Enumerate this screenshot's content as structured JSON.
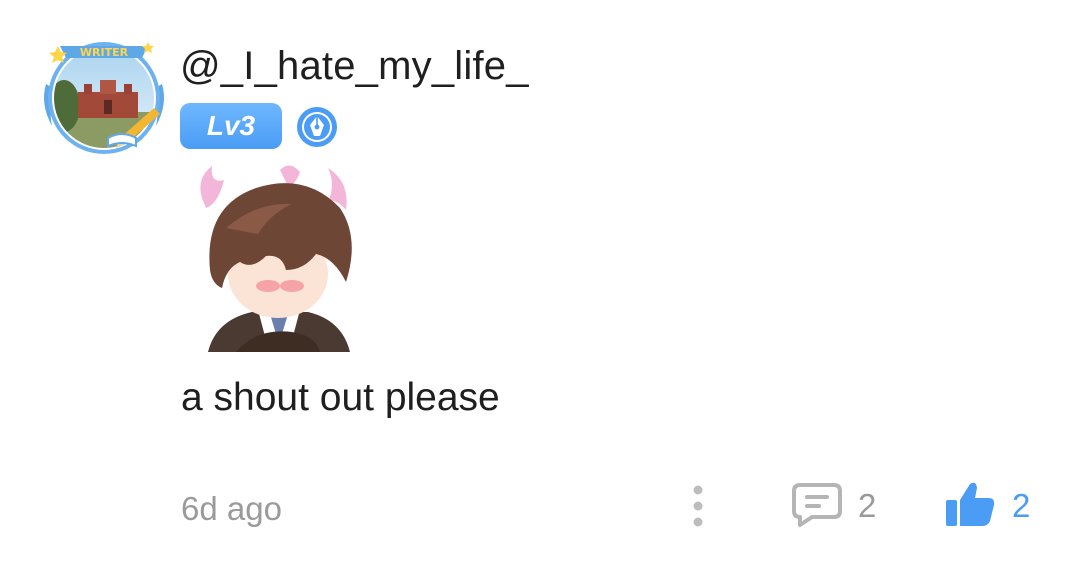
{
  "comment": {
    "username": "@_I_hate_my_life_",
    "avatar_frame_text": "WRITER",
    "level": "Lv3",
    "text": "a shout out please",
    "time": "6d ago",
    "reply_count": "2",
    "like_count": "2"
  },
  "icons": {
    "more": "more-vertical-icon",
    "reply": "comment-icon",
    "like": "thumbs-up-icon",
    "badge": "pen-nib-badge-icon"
  },
  "colors": {
    "accent": "#4a9cf5",
    "text": "#1f1f1f",
    "muted": "#9a9a9a"
  }
}
